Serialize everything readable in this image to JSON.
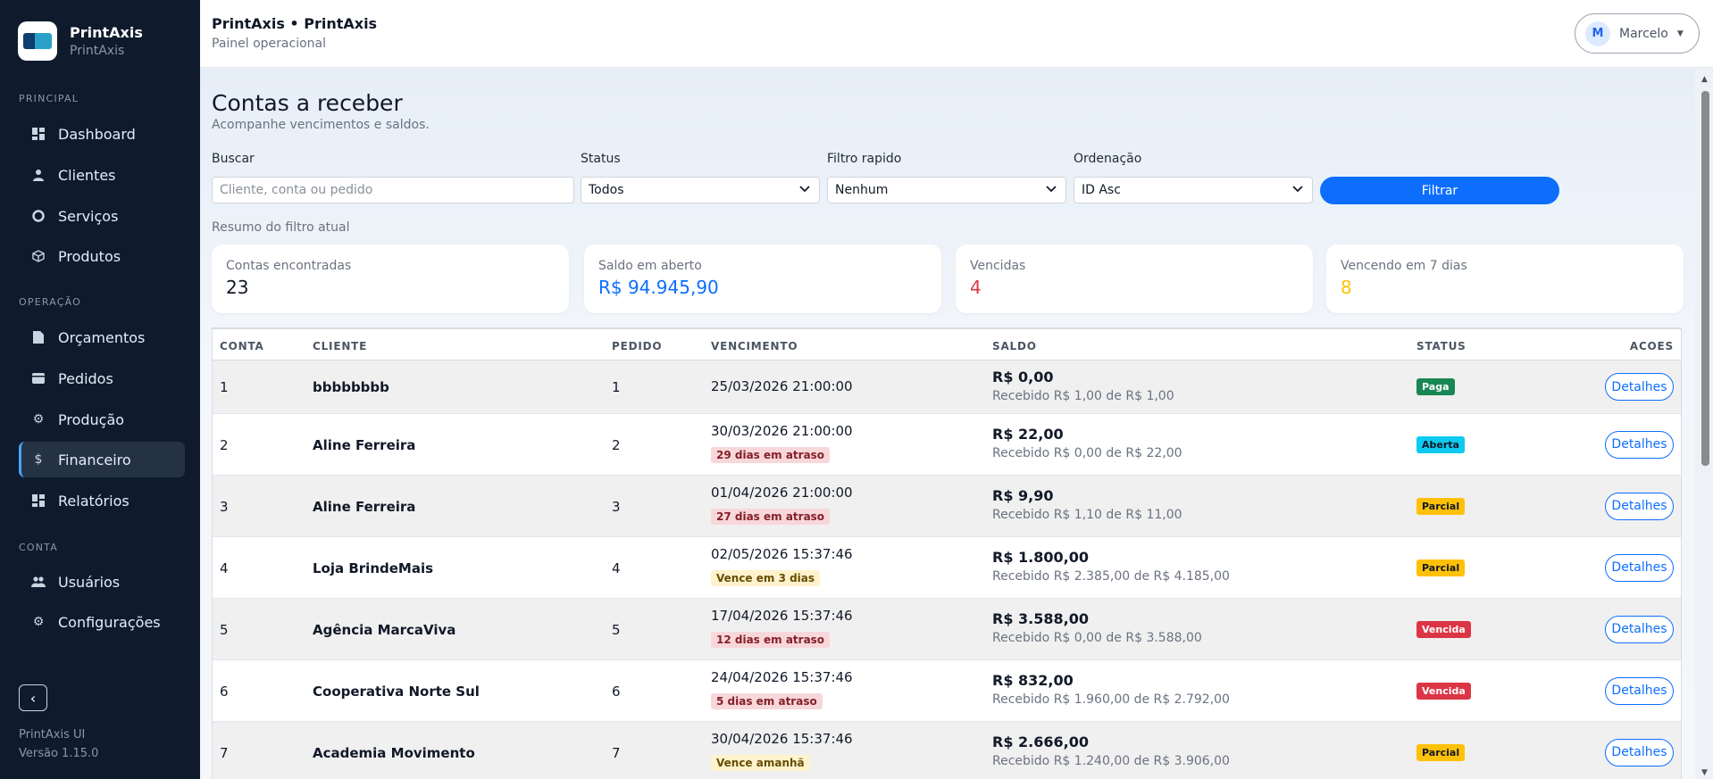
{
  "brand": {
    "name": "PrintAxis",
    "subtitle": "PrintAxis"
  },
  "sidebar": {
    "sections": [
      "PRINCIPAL",
      "OPERAÇÃO",
      "CONTA"
    ],
    "items": [
      {
        "label": "Dashboard",
        "icon": "dashboard-icon"
      },
      {
        "label": "Clientes",
        "icon": "user-icon"
      },
      {
        "label": "Serviços",
        "icon": "tools-icon"
      },
      {
        "label": "Produtos",
        "icon": "box-icon"
      },
      {
        "label": "Orçamentos",
        "icon": "document-icon"
      },
      {
        "label": "Pedidos",
        "icon": "wallet-icon"
      },
      {
        "label": "Produção",
        "icon": "gear-icon"
      },
      {
        "label": "Financeiro",
        "icon": "dollar-icon",
        "active": true
      },
      {
        "label": "Relatórios",
        "icon": "grid-icon"
      },
      {
        "label": "Usuários",
        "icon": "users-icon"
      },
      {
        "label": "Configurações",
        "icon": "gear-icon"
      }
    ],
    "footer_app": "PrintAxis UI",
    "footer_version": "Versão 1.15.0"
  },
  "topbar": {
    "title": "PrintAxis • PrintAxis",
    "subtitle": "Painel operacional",
    "user_initial": "M",
    "user_name": "Marcelo"
  },
  "page": {
    "title": "Contas a receber",
    "subtitle": "Acompanhe vencimentos e saldos."
  },
  "filters": {
    "search_label": "Buscar",
    "search_placeholder": "Cliente, conta ou pedido",
    "status_label": "Status",
    "status_value": "Todos",
    "quick_label": "Filtro rapido",
    "quick_value": "Nenhum",
    "order_label": "Ordenação",
    "order_value": "ID Asc",
    "submit_label": "Filtrar",
    "summary_label": "Resumo do filtro atual"
  },
  "summary": {
    "found_label": "Contas encontradas",
    "found_value": "23",
    "open_label": "Saldo em aberto",
    "open_value": "R$ 94.945,90",
    "overdue_label": "Vencidas",
    "overdue_value": "4",
    "due7_label": "Vencendo em 7 dias",
    "due7_value": "8",
    "colors": {
      "open": "#0d6efd",
      "overdue": "#dc3545",
      "due7": "#ffc107"
    }
  },
  "table": {
    "headers": [
      "CONTA",
      "CLIENTE",
      "PEDIDO",
      "VENCIMENTO",
      "SALDO",
      "STATUS",
      "ACOES"
    ],
    "action_label": "Detalhes",
    "rows": [
      {
        "conta": "1",
        "cliente": "bbbbbbbb",
        "pedido": "1",
        "vencimento": "25/03/2026 21:00:00",
        "badge": "",
        "badge_type": "",
        "saldo": "R$ 0,00",
        "recebido": "Recebido R$ 1,00 de R$ 1,00",
        "status": "Paga",
        "status_type": "paga"
      },
      {
        "conta": "2",
        "cliente": "Aline Ferreira",
        "pedido": "2",
        "vencimento": "30/03/2026 21:00:00",
        "badge": "29 dias em atraso",
        "badge_type": "late",
        "saldo": "R$ 22,00",
        "recebido": "Recebido R$ 0,00 de R$ 22,00",
        "status": "Aberta",
        "status_type": "aberta"
      },
      {
        "conta": "3",
        "cliente": "Aline Ferreira",
        "pedido": "3",
        "vencimento": "01/04/2026 21:00:00",
        "badge": "27 dias em atraso",
        "badge_type": "late",
        "saldo": "R$ 9,90",
        "recebido": "Recebido R$ 1,10 de R$ 11,00",
        "status": "Parcial",
        "status_type": "parcial"
      },
      {
        "conta": "4",
        "cliente": "Loja BrindeMais",
        "pedido": "4",
        "vencimento": "02/05/2026 15:37:46",
        "badge": "Vence em 3 dias",
        "badge_type": "soon",
        "saldo": "R$ 1.800,00",
        "recebido": "Recebido R$ 2.385,00 de R$ 4.185,00",
        "status": "Parcial",
        "status_type": "parcial"
      },
      {
        "conta": "5",
        "cliente": "Agência MarcaViva",
        "pedido": "5",
        "vencimento": "17/04/2026 15:37:46",
        "badge": "12 dias em atraso",
        "badge_type": "late",
        "saldo": "R$ 3.588,00",
        "recebido": "Recebido R$ 0,00 de R$ 3.588,00",
        "status": "Vencida",
        "status_type": "vencida"
      },
      {
        "conta": "6",
        "cliente": "Cooperativa Norte Sul",
        "pedido": "6",
        "vencimento": "24/04/2026 15:37:46",
        "badge": "5 dias em atraso",
        "badge_type": "late",
        "saldo": "R$ 832,00",
        "recebido": "Recebido R$ 1.960,00 de R$ 2.792,00",
        "status": "Vencida",
        "status_type": "vencida"
      },
      {
        "conta": "7",
        "cliente": "Academia Movimento",
        "pedido": "7",
        "vencimento": "30/04/2026 15:37:46",
        "badge": "Vence amanhã",
        "badge_type": "soon",
        "saldo": "R$ 2.666,00",
        "recebido": "Recebido R$ 1.240,00 de R$ 3.906,00",
        "status": "Parcial",
        "status_type": "parcial"
      }
    ]
  }
}
